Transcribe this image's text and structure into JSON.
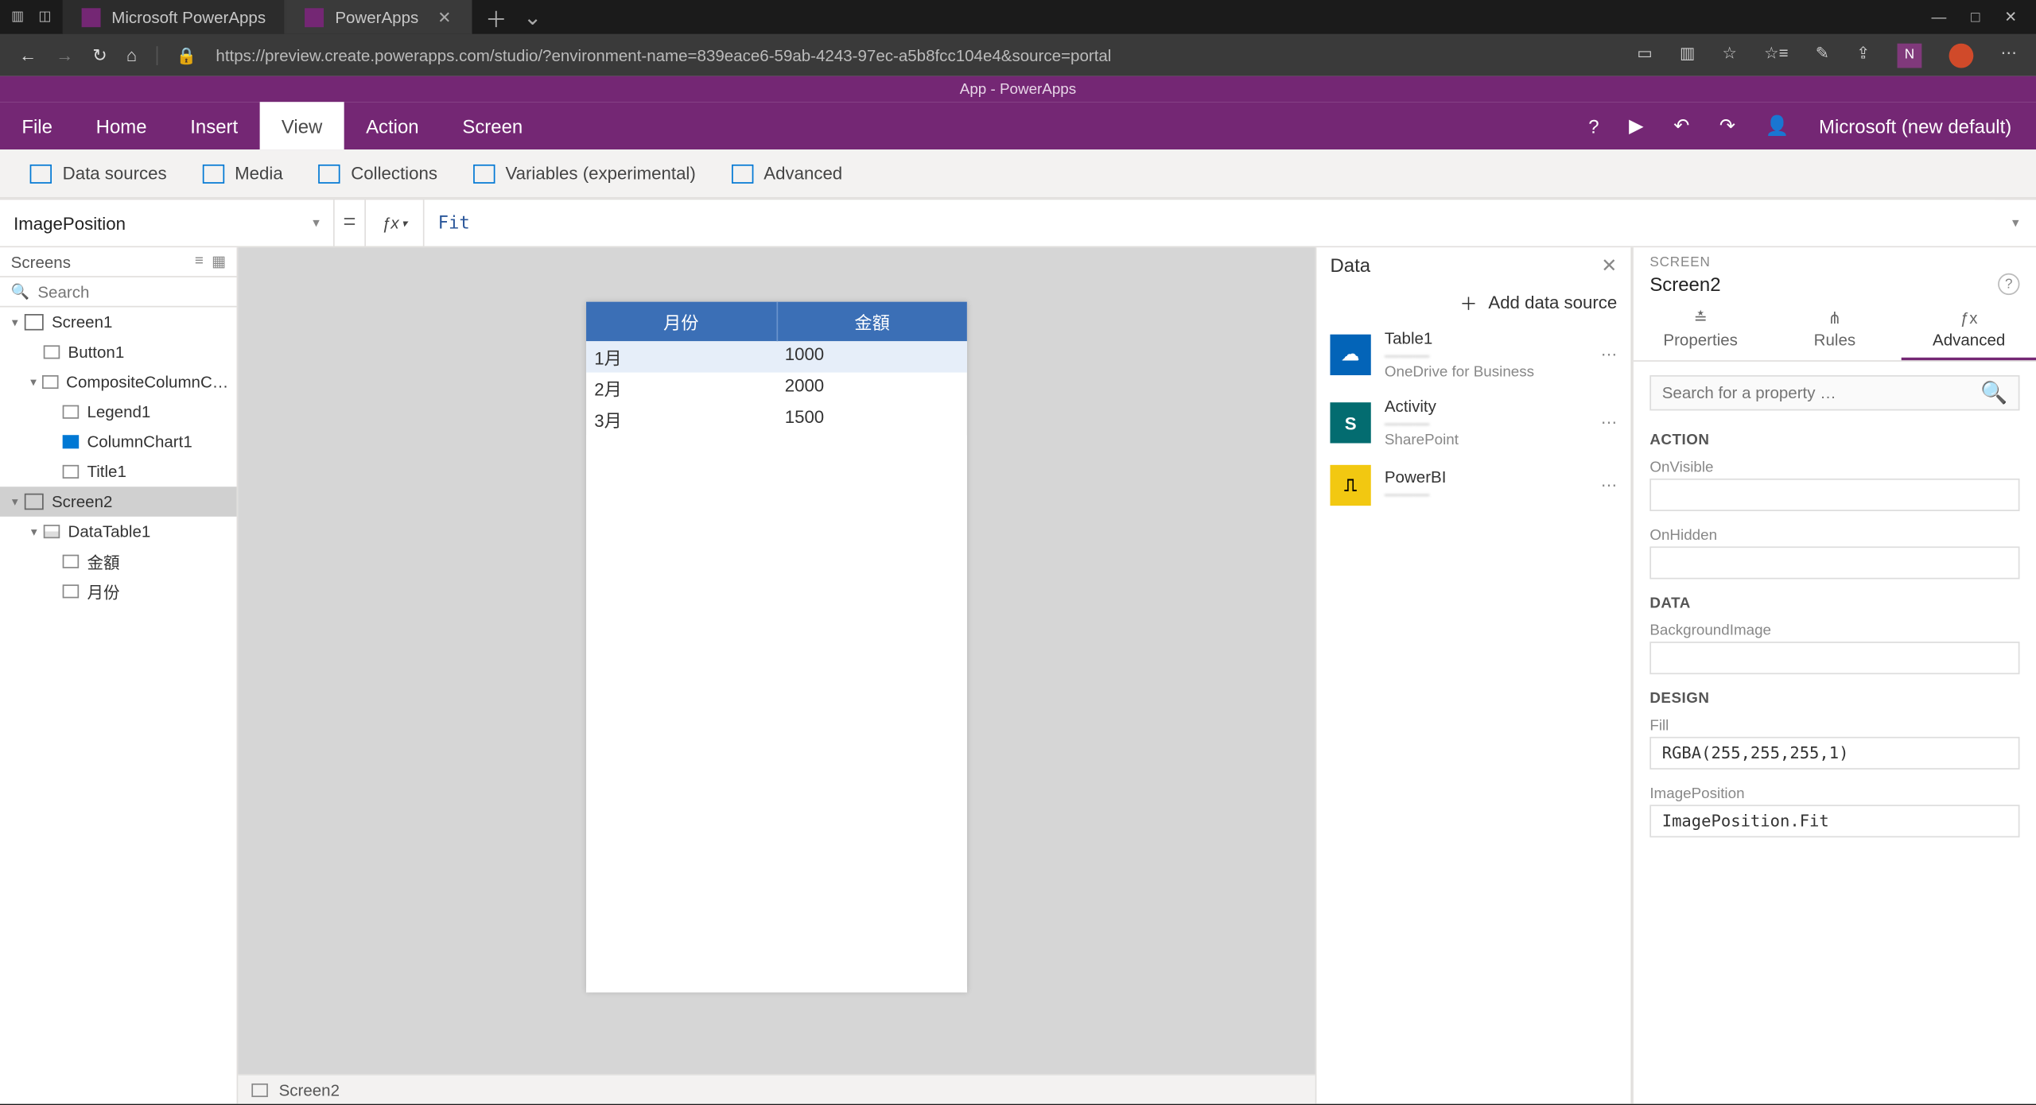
{
  "browser": {
    "tabs": [
      {
        "title": "Microsoft PowerApps",
        "active": false
      },
      {
        "title": "PowerApps",
        "active": true
      }
    ],
    "url": "https://preview.create.powerapps.com/studio/?environment-name=839eace6-59ab-4243-97ec-a5b8fcc104e4&source=portal"
  },
  "app_title": "App - PowerApps",
  "ribbon": {
    "tabs": [
      "File",
      "Home",
      "Insert",
      "View",
      "Action",
      "Screen"
    ],
    "active": "View",
    "right_user": "Microsoft (new default)"
  },
  "subribbon": {
    "items": [
      "Data sources",
      "Media",
      "Collections",
      "Variables (experimental)",
      "Advanced"
    ]
  },
  "formula": {
    "property": "ImagePosition",
    "value": "Fit"
  },
  "tree": {
    "title": "Screens",
    "search_placeholder": "Search",
    "nodes": [
      {
        "depth": 0,
        "expand": "▾",
        "icon": "screen",
        "label": "Screen1",
        "sel": false
      },
      {
        "depth": 1,
        "expand": "",
        "icon": "box",
        "label": "Button1",
        "sel": false
      },
      {
        "depth": 1,
        "expand": "▾",
        "icon": "comp",
        "label": "CompositeColumnC…",
        "sel": false
      },
      {
        "depth": 2,
        "expand": "",
        "icon": "box",
        "label": "Legend1",
        "sel": false
      },
      {
        "depth": 2,
        "expand": "",
        "icon": "chart",
        "label": "ColumnChart1",
        "sel": false
      },
      {
        "depth": 2,
        "expand": "",
        "icon": "text",
        "label": "Title1",
        "sel": false
      },
      {
        "depth": 0,
        "expand": "▾",
        "icon": "screen",
        "label": "Screen2",
        "sel": true
      },
      {
        "depth": 1,
        "expand": "▾",
        "icon": "table",
        "label": "DataTable1",
        "sel": false
      },
      {
        "depth": 2,
        "expand": "",
        "icon": "box",
        "label": "金額",
        "sel": false
      },
      {
        "depth": 2,
        "expand": "",
        "icon": "box",
        "label": "月份",
        "sel": false
      }
    ]
  },
  "canvas": {
    "table": {
      "headers": [
        "月份",
        "金額"
      ],
      "rows": [
        {
          "c0": "1月",
          "c1": "1000",
          "sel": true
        },
        {
          "c0": "2月",
          "c1": "2000",
          "sel": false
        },
        {
          "c0": "3月",
          "c1": "1500",
          "sel": false
        }
      ]
    },
    "status": "Screen2"
  },
  "data_panel": {
    "title": "Data",
    "add_label": "Add data source",
    "sources": [
      {
        "icon": "onedrive",
        "glyph": "☁",
        "title": "Table1",
        "sub": "———",
        "src": "OneDrive for Business"
      },
      {
        "icon": "sp",
        "glyph": "S",
        "title": "Activity",
        "sub": "———",
        "src": "SharePoint"
      },
      {
        "icon": "pbi",
        "glyph": "⎍",
        "title": "PowerBI",
        "sub": "———",
        "src": ""
      }
    ]
  },
  "props": {
    "header_small": "SCREEN",
    "header_name": "Screen2",
    "tabs": [
      "Properties",
      "Rules",
      "Advanced"
    ],
    "active_tab": "Advanced",
    "search_placeholder": "Search for a property …",
    "sections": {
      "action_title": "ACTION",
      "action_fields": [
        {
          "label": "OnVisible",
          "value": ""
        },
        {
          "label": "OnHidden",
          "value": ""
        }
      ],
      "data_title": "DATA",
      "data_fields": [
        {
          "label": "BackgroundImage",
          "value": ""
        }
      ],
      "design_title": "DESIGN",
      "design_fields": [
        {
          "label": "Fill",
          "value": "RGBA(255,255,255,1)"
        },
        {
          "label": "ImagePosition",
          "value": "ImagePosition.Fit"
        }
      ]
    }
  }
}
